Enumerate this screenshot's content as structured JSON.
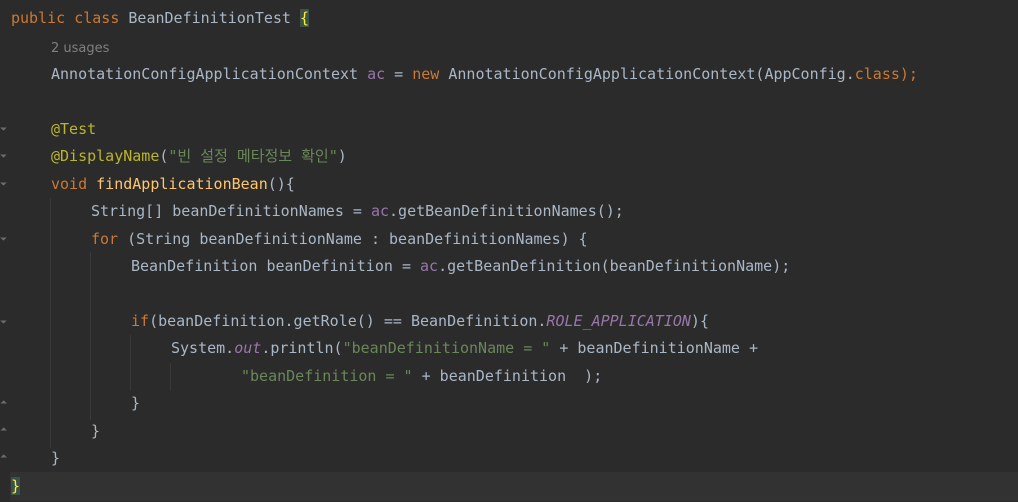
{
  "code": {
    "l1_kw1": "public",
    "l1_kw2": "class",
    "l1_name": "BeanDefinitionTest",
    "l1_brace": "{",
    "usage_hint": "2 usages",
    "l3_type": "AnnotationConfigApplicationContext",
    "l3_var": "ac",
    "l3_eq": "=",
    "l3_new": "new",
    "l3_ctor": "AnnotationConfigApplicationContext",
    "l3_arg": "AppConfig.",
    "l3_class": "class",
    "l3_end": ");",
    "ann_test": "@Test",
    "ann_display": "@DisplayName",
    "display_open": "(",
    "display_str": "\"빈 설정 메타정보 확인\"",
    "display_close": ")",
    "m_void": "void",
    "m_name": "findApplicationBean",
    "m_sig": "(){",
    "l7_type": "String[]",
    "l7_var": "beanDefinitionNames",
    "l7_eq": "=",
    "l7_recv": "ac",
    "l7_call": ".getBeanDefinitionNames();",
    "l8_for": "for",
    "l8_rest": "(String beanDefinitionName : beanDefinitionNames) {",
    "l9_type": "BeanDefinition",
    "l9_var": "beanDefinition",
    "l9_eq": "=",
    "l9_recv": "ac",
    "l9_call": ".getBeanDefinition(beanDefinitionName);",
    "l11_if": "if",
    "l11_mid": "(beanDefinition.getRole() == BeanDefinition.",
    "l11_const": "ROLE_APPLICATION",
    "l11_end": "){",
    "l12_sys": "System.",
    "l12_out": "out",
    "l12_println": ".println(",
    "l12_str": "\"beanDefinitionName = \"",
    "l12_rest": " + beanDefinitionName +",
    "l13_str": "\"beanDefinition = \"",
    "l13_rest": " + beanDefinition  );",
    "close_if": "}",
    "close_for": "}",
    "close_method": "}",
    "close_class": "}"
  },
  "colors": {
    "background": "#2b2b2b",
    "keyword": "#cc7832",
    "function": "#ffc66d",
    "string": "#6a8759",
    "annotation": "#bbb529",
    "field": "#9876aa",
    "text": "#a9b7c6"
  }
}
